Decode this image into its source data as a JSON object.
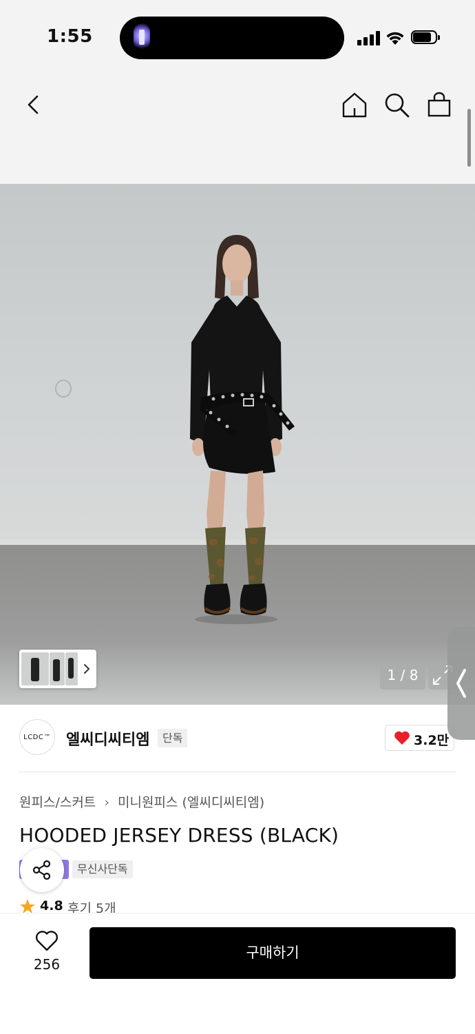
{
  "status_bar": {
    "time": "1:55"
  },
  "gallery": {
    "page_counter": "1 / 8"
  },
  "brand": {
    "logo_text": "LCDC™",
    "name": "엘씨디씨티엠",
    "exclusive_tag": "단독",
    "likes": "3.2만"
  },
  "breadcrumb": {
    "category": "원피스/스커트",
    "subcategory": "미니원피스 (엘씨디씨티엠)"
  },
  "product": {
    "title": "HOODED JERSEY DRESS (BLACK)",
    "badge": "무신사단독"
  },
  "rating": {
    "score": "4.8",
    "reviews": "후기 5개"
  },
  "bottom_bar": {
    "wish_count": "256",
    "buy_label": "구매하기"
  },
  "icons": [
    "back-icon",
    "home-icon",
    "search-icon",
    "bag-icon",
    "share-icon",
    "heart-icon",
    "star-icon",
    "expand-icon",
    "chevron-right-icon",
    "chevron-left-icon"
  ],
  "colors": {
    "accent_red": "#e8202a",
    "star": "#f5a623",
    "badge_purple": "#8e79e0",
    "buy_button": "#000000"
  }
}
